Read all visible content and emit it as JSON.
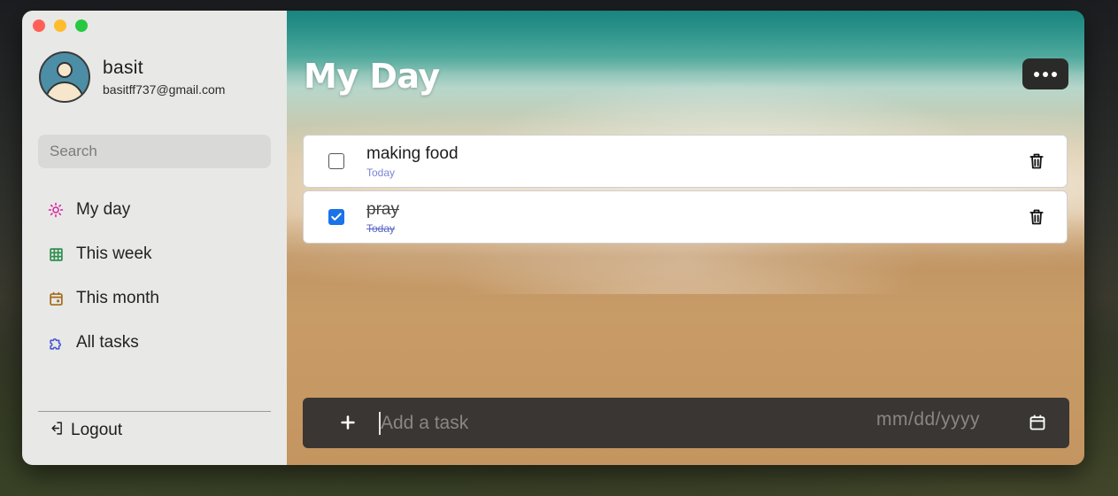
{
  "window": {
    "controls": [
      "close",
      "minimize",
      "zoom"
    ]
  },
  "profile": {
    "name": "basit",
    "email": "basitff737@gmail.com"
  },
  "search": {
    "placeholder": "Search"
  },
  "nav": {
    "items": [
      {
        "label": "My day",
        "icon": "sun-icon",
        "color": "#d6209a"
      },
      {
        "label": "This week",
        "icon": "grid-icon",
        "color": "#2e8f4e"
      },
      {
        "label": "This month",
        "icon": "calendar-icon",
        "color": "#a36b19"
      },
      {
        "label": "All tasks",
        "icon": "puzzle-icon",
        "color": "#4a57d1"
      }
    ]
  },
  "logout": {
    "label": "Logout"
  },
  "main": {
    "title": "My Day",
    "tasks": [
      {
        "title": "making food",
        "date": "Today",
        "done": false
      },
      {
        "title": "pray",
        "date": "Today",
        "done": true
      }
    ],
    "add_task": {
      "placeholder": "Add a task",
      "date_placeholder": "mm/dd/yyyy"
    }
  },
  "colors": {
    "accent_check": "#1a73e8",
    "task_date": "#7b84d6"
  }
}
